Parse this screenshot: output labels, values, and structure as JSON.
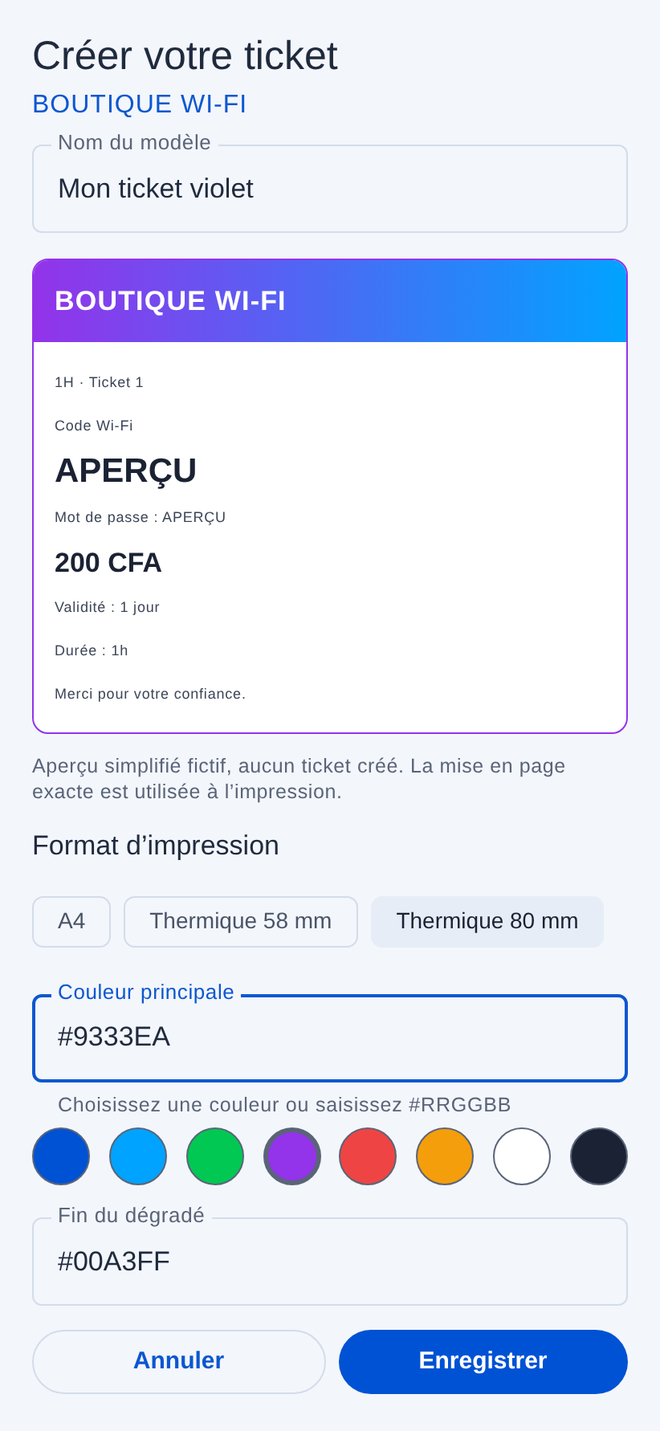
{
  "title": "Créer votre ticket",
  "subtitle": "BOUTIQUE WI-FI",
  "name_field": {
    "label": "Nom du modèle",
    "value": "Mon ticket violet",
    "focused": false
  },
  "ticket_preview": {
    "header": "BOUTIQUE WI-FI",
    "lines": [
      {
        "kind": "small",
        "text": "1H · Ticket 1"
      },
      {
        "kind": "small",
        "text": "Code Wi-Fi"
      },
      {
        "kind": "code",
        "text": "APERÇU"
      },
      {
        "kind": "small",
        "text": "Mot de passe : APERÇU"
      },
      {
        "kind": "price",
        "text": "200 CFA"
      },
      {
        "kind": "small",
        "text": "Validité : 1 jour"
      },
      {
        "kind": "small",
        "text": "Durée : 1h"
      },
      {
        "kind": "small",
        "text": "Merci pour votre confiance."
      }
    ]
  },
  "preview_note": "Aperçu simplifié fictif, aucun ticket créé. La mise en page exacte est utilisée à l’impression.",
  "format_heading": "Format d’impression",
  "formats": [
    {
      "label": "A4",
      "selected": false
    },
    {
      "label": "Thermique 58 mm",
      "selected": false
    },
    {
      "label": "Thermique 80 mm",
      "selected": true
    }
  ],
  "primary_field": {
    "label": "Couleur principale",
    "value": "#9333EA",
    "focused": true,
    "helper": "Choisissez une couleur ou saisissez #RRGGBB"
  },
  "swatches": [
    {
      "color": "#0052d4",
      "selected": false
    },
    {
      "color": "#00a3ff",
      "selected": false
    },
    {
      "color": "#00c853",
      "selected": false
    },
    {
      "color": "#9333ea",
      "selected": true
    },
    {
      "color": "#ef4444",
      "selected": false
    },
    {
      "color": "#f59e0b",
      "selected": false
    },
    {
      "color": "#ffffff",
      "selected": false
    },
    {
      "color": "#1a2233",
      "selected": false
    }
  ],
  "gradient_field": {
    "label": "Fin du dégradé",
    "value": "#00A3FF",
    "focused": false
  },
  "buttons": [
    {
      "kind": "secondary",
      "label": "Annuler"
    },
    {
      "kind": "primary",
      "label": "Enregistrer"
    }
  ]
}
